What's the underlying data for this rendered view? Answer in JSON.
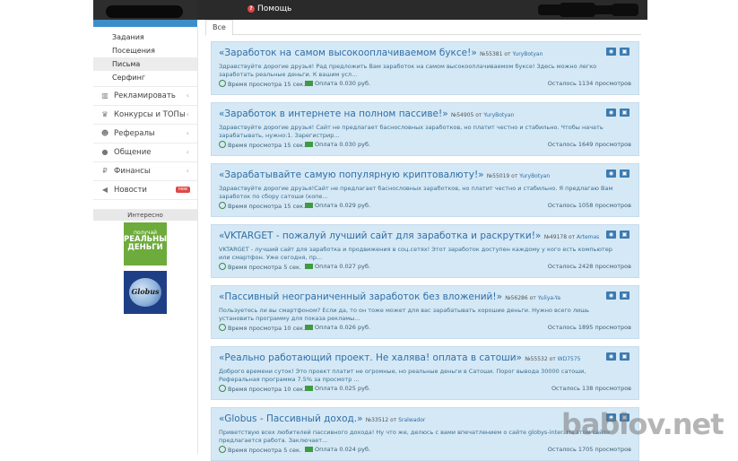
{
  "header": {
    "help_label": "Помощь"
  },
  "sidebar": {
    "sub_items": [
      "Задания",
      "Посещения",
      "Письма",
      "Серфинг"
    ],
    "menu": [
      {
        "label": "Рекламировать",
        "icon": "chart-icon"
      },
      {
        "label": "Конкурсы и ТОПы",
        "icon": "trophy-icon"
      },
      {
        "label": "Рефералы",
        "icon": "users-icon"
      },
      {
        "label": "Общение",
        "icon": "chat-icon"
      },
      {
        "label": "Финансы",
        "icon": "ruble-icon"
      },
      {
        "label": "Новости",
        "icon": "megaphone-icon",
        "badge": "new"
      }
    ],
    "interesting_label": "Интересно",
    "banner_money": {
      "line1": "получай",
      "line2": "РЕАЛЬНЫЕ",
      "line3": "ДЕНЬГИ"
    },
    "banner_globus": {
      "text": "Globus"
    }
  },
  "tabs": {
    "all_label": "Все"
  },
  "cards": [
    {
      "title": "«Заработок на самом высокооплачиваемом буксе!»",
      "id": "№55381",
      "by": "от",
      "author": "YuryBotyan",
      "desc": "Здравствуйте дорогие друзья! Рад предложить Вам заработок на самом высокооплачиваемом буксе! Здесь можно легко заработать реальные деньги. К вашим усл...",
      "time": "Время просмотра 15 сек.",
      "pay": "Оплата 0.030 руб.",
      "left": "Осталось 1134 просмотров"
    },
    {
      "title": "«Заработок в интернете на полном пассиве!»",
      "id": "№54905",
      "by": "от",
      "author": "YuryBotyan",
      "desc": "Здравствуйте дорогие друзья! Сайт не предлагает баснословных заработков, но платит честно и стабильно. Чтобы начать зарабатывать, нужно:1. Зарегистрир...",
      "time": "Время просмотра 15 сек.",
      "pay": "Оплата 0.030 руб.",
      "left": "Осталось 1649 просмотров"
    },
    {
      "title": "«Зарабатывайте самую популярную криптовалюту!»",
      "id": "№55019",
      "by": "от",
      "author": "YuryBotyan",
      "desc": "Здравствуйте дорогие друзья!Сайт не предлагает баснословных заработков, но платит честно и стабильно.  Я предлагаю Вам заработок по сбору сатоши (копе...",
      "time": "Время просмотра 15 сек.",
      "pay": "Оплата 0.029 руб.",
      "left": "Осталось 1058 просмотров"
    },
    {
      "title": "«VKTARGET - пожалуй лучший сайт для заработка и раскрутки!»",
      "id": "№49178",
      "by": "от",
      "author": "Artemaster",
      "desc": "VKTARGET - лучший сайт для заработка и продвижения в соц.сетях! Этот заработок доступен каждому у кого есть компьютер или смартфон. Уже сегодня, пр...",
      "time": "Время просмотра 5 сек.",
      "pay": "Оплата 0.027 руб.",
      "left": "Осталось 2428 просмотров"
    },
    {
      "title": "«Пассивный неограниченный заработок без вложений!»",
      "id": "№56286",
      "by": "от",
      "author": "Yuliya-Ya",
      "desc": "Пользуетесь ли вы смартфоном? Если да, то он тоже может для вас зарабатывать хорошие деньги. Нужно всего лишь установить программу для показа рекламы...",
      "time": "Время просмотра 10 сек.",
      "pay": "Оплата 0.026 руб.",
      "left": "Осталось 1895 просмотров"
    },
    {
      "title": "«Реально работающий проект. Не халява! оплата в сатоши»",
      "id": "№55532",
      "by": "от",
      "author": "WD7575",
      "desc": "Доброго времени суток! Это проект платит не огромные, но реальные деньги в Сатоши. Порог вывода 30000 сатоши, Реферальная программа 7.5%  за просмотр ...",
      "time": "Время просмотра 10 сек.",
      "pay": "Оплата 0.025 руб.",
      "left": "Осталось 138 просмотров"
    },
    {
      "title": "«Globus - Пассивный доход.»",
      "id": "№33512",
      "by": "от",
      "author": "Sralwador",
      "desc": "Приветствую всех любителей пассивного дохода! Ну что же, делюсь с вами впечатлением о сайте globys-inter. На этом сайте предлагается работа. Заключает...",
      "time": "Время просмотра 5 сек.",
      "pay": "Оплата 0.024 руб.",
      "left": "Осталось 1705 просмотров"
    }
  ],
  "watermark": "bablov.net"
}
